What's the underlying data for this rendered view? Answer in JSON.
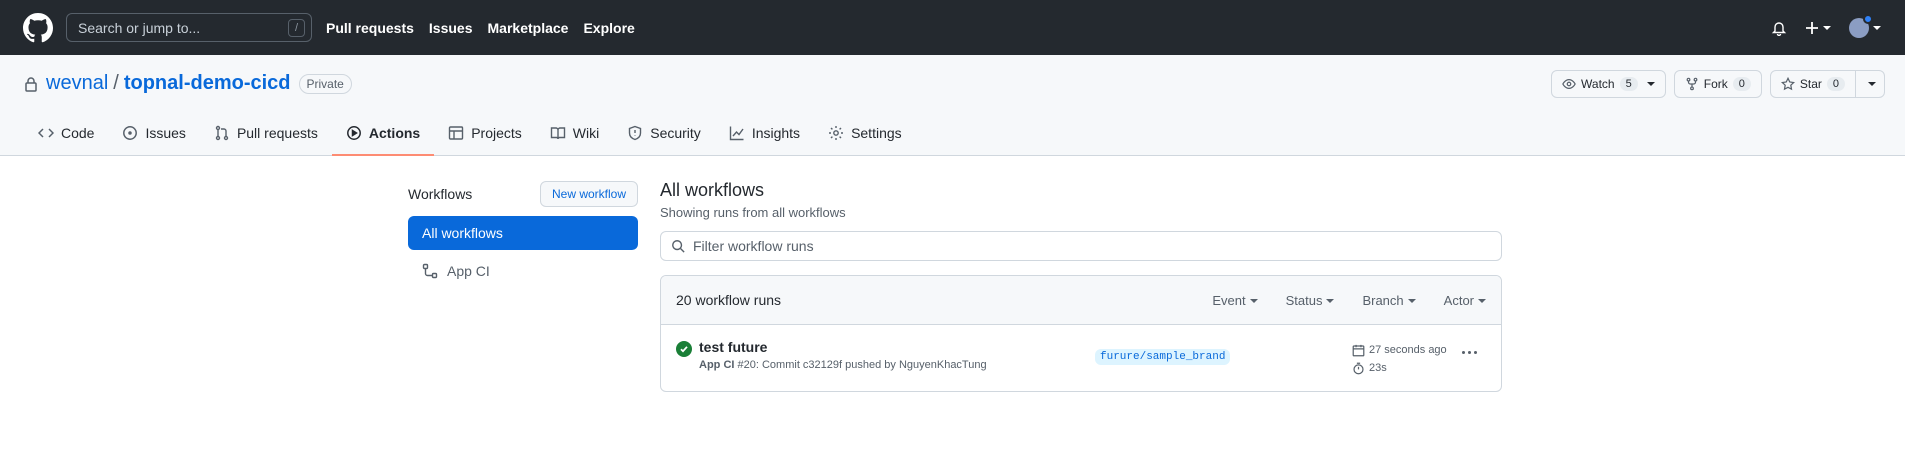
{
  "header": {
    "search_placeholder": "Search or jump to...",
    "search_hotkey": "/",
    "nav": [
      "Pull requests",
      "Issues",
      "Marketplace",
      "Explore"
    ]
  },
  "repo": {
    "owner": "wevnal",
    "separator": "/",
    "name": "topnal-demo-cicd",
    "visibility": "Private",
    "watch_label": "Watch",
    "watch_count": "5",
    "fork_label": "Fork",
    "fork_count": "0",
    "star_label": "Star",
    "star_count": "0"
  },
  "tabs": [
    {
      "label": "Code",
      "icon": "code-icon"
    },
    {
      "label": "Issues",
      "icon": "issue-opened-icon"
    },
    {
      "label": "Pull requests",
      "icon": "git-pull-request-icon"
    },
    {
      "label": "Actions",
      "icon": "play-icon",
      "active": true
    },
    {
      "label": "Projects",
      "icon": "table-icon"
    },
    {
      "label": "Wiki",
      "icon": "book-icon"
    },
    {
      "label": "Security",
      "icon": "shield-icon"
    },
    {
      "label": "Insights",
      "icon": "graph-icon"
    },
    {
      "label": "Settings",
      "icon": "gear-icon"
    }
  ],
  "sidebar": {
    "title": "Workflows",
    "new_button": "New workflow",
    "items": [
      {
        "label": "All workflows",
        "selected": true
      },
      {
        "label": "App CI",
        "selected": false
      }
    ]
  },
  "main": {
    "title": "All workflows",
    "subtitle": "Showing runs from all workflows",
    "filter_placeholder": "Filter workflow runs",
    "runs_count": "20 workflow runs",
    "filters": [
      "Event",
      "Status",
      "Branch",
      "Actor"
    ],
    "runs": [
      {
        "title": "test future",
        "workflow": "App CI",
        "detail": "#20: Commit c32129f pushed by NguyenKhacTung",
        "branch": "furure/sample_brand",
        "time_ago": "27 seconds ago",
        "duration": "23s",
        "status": "success"
      }
    ]
  },
  "colors": {
    "header_bg": "#24292f",
    "accent": "#0969da",
    "success": "#1a7f37",
    "active_tab_underline": "#fd8c73"
  }
}
